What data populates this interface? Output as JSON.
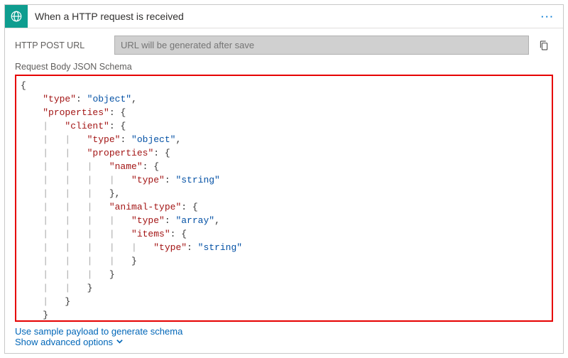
{
  "header": {
    "title": "When a HTTP request is received",
    "more_label": "···",
    "icon": "globe-arrow-icon"
  },
  "url_row": {
    "label": "HTTP POST URL",
    "placeholder": "URL will be generated after save",
    "copy_label": "Copy"
  },
  "schema": {
    "label": "Request Body JSON Schema",
    "keys": {
      "type": "\"type\"",
      "properties": "\"properties\"",
      "client": "\"client\"",
      "name": "\"name\"",
      "animal_type": "\"animal-type\"",
      "items": "\"items\""
    },
    "values": {
      "object": "\"object\"",
      "string": "\"string\"",
      "array": "\"array\""
    }
  },
  "links": {
    "sample_payload": "Use sample payload to generate schema",
    "advanced": "Show advanced options"
  }
}
